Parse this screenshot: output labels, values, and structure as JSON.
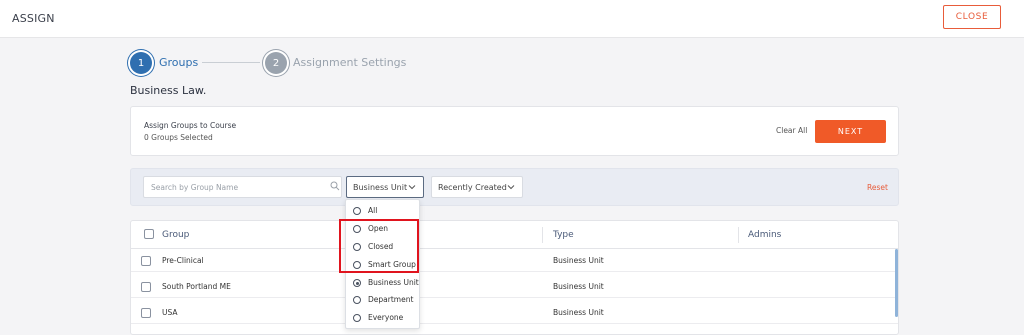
{
  "header": {
    "title": "ASSIGN",
    "close_label": "CLOSE"
  },
  "stepper": {
    "steps": [
      {
        "number": "1",
        "label": "Groups",
        "state": "active"
      },
      {
        "number": "2",
        "label": "Assignment Settings",
        "state": "inactive"
      }
    ]
  },
  "course": {
    "title": "Business Law."
  },
  "summary": {
    "heading": "Assign Groups to Course",
    "selected_count": "0 Groups Selected",
    "clear_all_label": "Clear All",
    "next_label": "NEXT"
  },
  "filters": {
    "search_placeholder": "Search by Group Name",
    "type_filter": "Business Unit",
    "sort_filter": "Recently Created",
    "reset_label": "Reset"
  },
  "table": {
    "columns": [
      "Group",
      "Type",
      "Admins"
    ],
    "rows": [
      {
        "group": "Pre-Clinical",
        "type": "Business Unit"
      },
      {
        "group": "South Portland ME",
        "type": "Business Unit"
      },
      {
        "group": "USA",
        "type": "Business Unit"
      }
    ]
  },
  "type_menu": {
    "options": [
      "All",
      "Open",
      "Closed",
      "Smart Group",
      "Business Unit",
      "Department",
      "Everyone"
    ],
    "selected": "Business Unit"
  },
  "colors": {
    "accent": "#f05a28",
    "primary": "#2f6fb0",
    "highlight": "#e0141e"
  }
}
